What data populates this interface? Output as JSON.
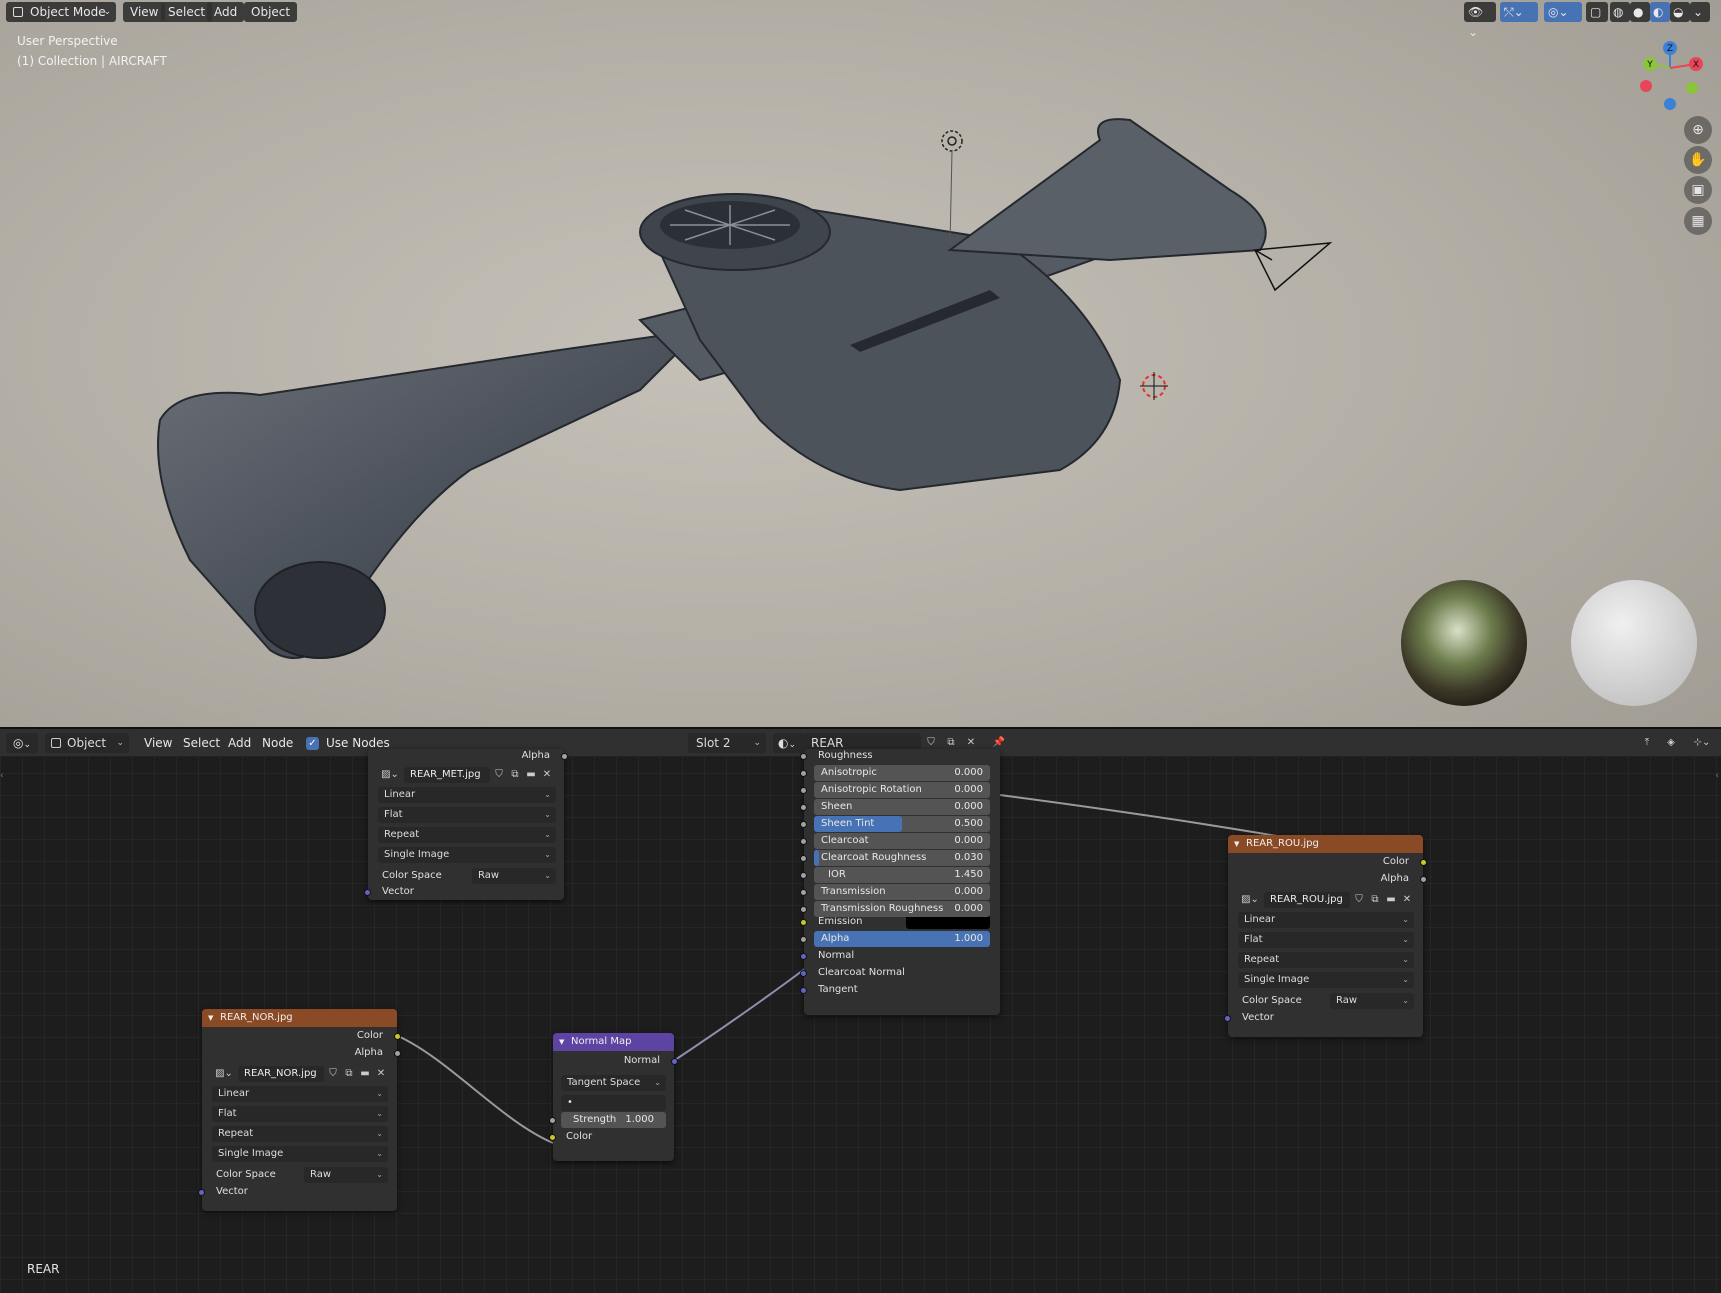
{
  "viewport": {
    "mode_label": "Object Mode",
    "menu": [
      "View",
      "Select",
      "Add",
      "Object"
    ],
    "view_name": "User Perspective",
    "collection_info": "(1) Collection | AIRCRAFT",
    "axis_labels": {
      "x": "X",
      "y": "Y",
      "z": "Z"
    },
    "colors": {
      "x": "#e94559",
      "y": "#8cc43c",
      "z": "#3b82d6"
    }
  },
  "node_editor": {
    "editor_type": "Object",
    "menu": [
      "View",
      "Select",
      "Add",
      "Node"
    ],
    "use_nodes_label": "Use Nodes",
    "use_nodes_checked": true,
    "slot": "Slot 2",
    "material_name": "REAR",
    "footer_label": "REAR"
  },
  "nodes": {
    "met": {
      "alpha": "Alpha",
      "image": "REAR_MET.jpg",
      "interpolation": "Linear",
      "projection": "Flat",
      "extension": "Repeat",
      "source": "Single Image",
      "color_space_label": "Color Space",
      "color_space": "Raw",
      "vector": "Vector"
    },
    "nor": {
      "title": "REAR_NOR.jpg",
      "color": "Color",
      "alpha": "Alpha",
      "image": "REAR_NOR.jpg",
      "interpolation": "Linear",
      "projection": "Flat",
      "extension": "Repeat",
      "source": "Single Image",
      "color_space_label": "Color Space",
      "color_space": "Raw",
      "vector": "Vector"
    },
    "normal_map": {
      "title": "Normal Map",
      "normal": "Normal",
      "space": "Tangent Space",
      "uv": "•",
      "strength_label": "Strength",
      "strength": "1.000",
      "color": "Color"
    },
    "bsdf": {
      "roughness": "Roughness",
      "fields": [
        {
          "label": "Anisotropic",
          "value": "0.000",
          "fill": 0
        },
        {
          "label": "Anisotropic Rotation",
          "value": "0.000",
          "fill": 0
        },
        {
          "label": "Sheen",
          "value": "0.000",
          "fill": 0
        },
        {
          "label": "Sheen Tint",
          "value": "0.500",
          "fill": 0.5
        },
        {
          "label": "Clearcoat",
          "value": "0.000",
          "fill": 0
        },
        {
          "label": "Clearcoat Roughness",
          "value": "0.030",
          "fill": 0.03
        },
        {
          "label": "IOR",
          "value": "1.450",
          "fill": 0
        },
        {
          "label": "Transmission",
          "value": "0.000",
          "fill": 0
        },
        {
          "label": "Transmission Roughness",
          "value": "0.000",
          "fill": 0
        }
      ],
      "emission": "Emission",
      "alpha_label": "Alpha",
      "alpha_value": "1.000",
      "normal": "Normal",
      "clearcoat_normal": "Clearcoat Normal",
      "tangent": "Tangent"
    },
    "rou": {
      "title": "REAR_ROU.jpg",
      "color": "Color",
      "alpha": "Alpha",
      "image": "REAR_ROU.jpg",
      "interpolation": "Linear",
      "projection": "Flat",
      "extension": "Repeat",
      "source": "Single Image",
      "color_space_label": "Color Space",
      "color_space": "Raw",
      "vector": "Vector"
    }
  }
}
